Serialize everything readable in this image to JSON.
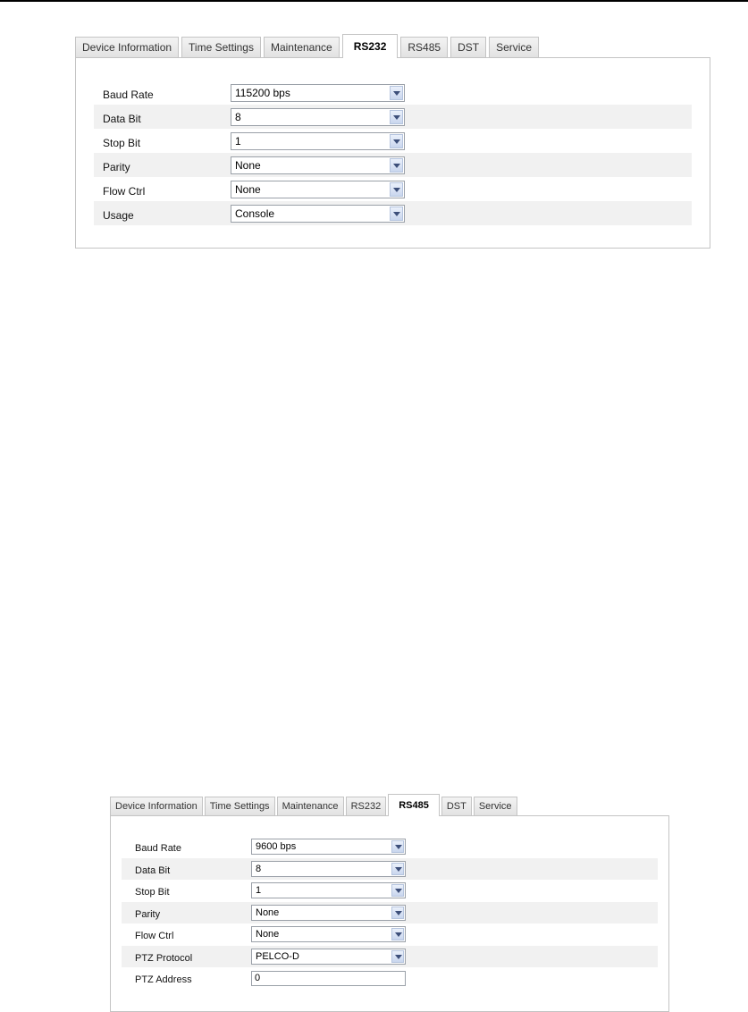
{
  "panel1": {
    "tabs": [
      {
        "label": "Device Information",
        "active": false
      },
      {
        "label": "Time Settings",
        "active": false
      },
      {
        "label": "Maintenance",
        "active": false
      },
      {
        "label": "RS232",
        "active": true
      },
      {
        "label": "RS485",
        "active": false
      },
      {
        "label": "DST",
        "active": false
      },
      {
        "label": "Service",
        "active": false
      }
    ],
    "fields": {
      "baud_rate": {
        "label": "Baud Rate",
        "value": "115200 bps"
      },
      "data_bit": {
        "label": "Data Bit",
        "value": "8"
      },
      "stop_bit": {
        "label": "Stop Bit",
        "value": "1"
      },
      "parity": {
        "label": "Parity",
        "value": "None"
      },
      "flow_ctrl": {
        "label": "Flow Ctrl",
        "value": "None"
      },
      "usage": {
        "label": "Usage",
        "value": "Console"
      }
    }
  },
  "panel2": {
    "tabs": [
      {
        "label": "Device Information",
        "active": false
      },
      {
        "label": "Time Settings",
        "active": false
      },
      {
        "label": "Maintenance",
        "active": false
      },
      {
        "label": "RS232",
        "active": false
      },
      {
        "label": "RS485",
        "active": true
      },
      {
        "label": "DST",
        "active": false
      },
      {
        "label": "Service",
        "active": false
      }
    ],
    "fields": {
      "baud_rate": {
        "label": "Baud Rate",
        "value": "9600 bps"
      },
      "data_bit": {
        "label": "Data Bit",
        "value": "8"
      },
      "stop_bit": {
        "label": "Stop Bit",
        "value": "1"
      },
      "parity": {
        "label": "Parity",
        "value": "None"
      },
      "flow_ctrl": {
        "label": "Flow Ctrl",
        "value": "None"
      },
      "ptz_protocol": {
        "label": "PTZ Protocol",
        "value": "PELCO-D"
      },
      "ptz_address": {
        "label": "PTZ Address",
        "value": "0"
      }
    }
  },
  "icons": {
    "dropdown": "chevron-down-icon"
  },
  "colors": {
    "tab_border": "#c4c4c4",
    "row_alt": "#f1f1f1",
    "arrow": "#3d4f7a"
  }
}
